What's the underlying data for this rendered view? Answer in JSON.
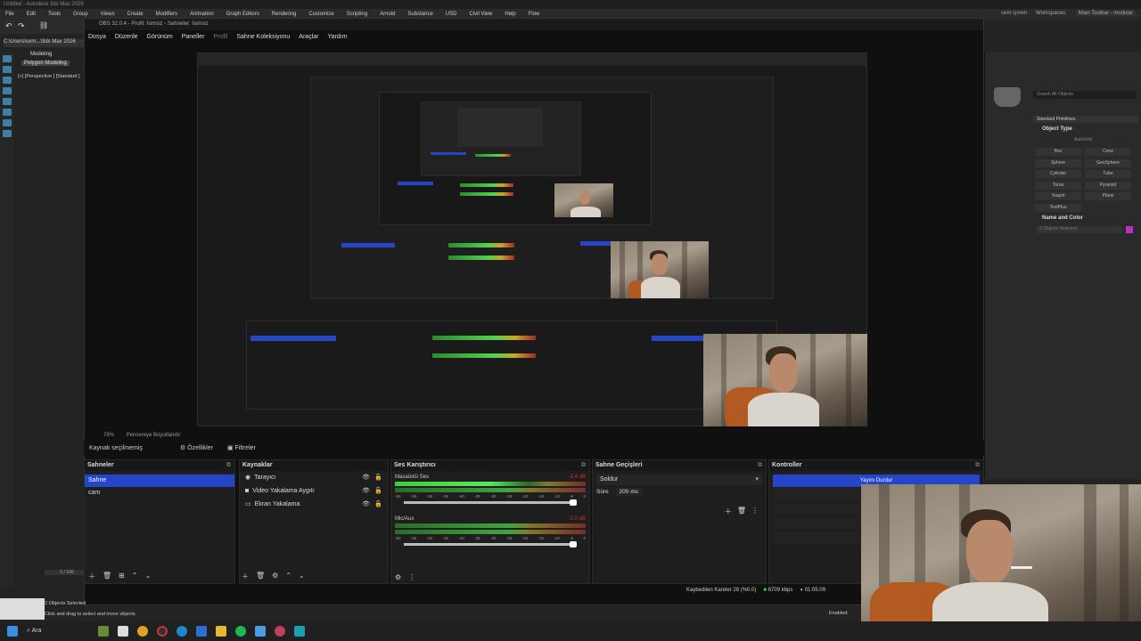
{
  "max": {
    "title": "Untitled - Autodesk 3ds Max 2026",
    "menu": [
      "File",
      "Edit",
      "Tools",
      "Group",
      "Views",
      "Create",
      "Modifiers",
      "Animation",
      "Graph Editors",
      "Rendering",
      "Customize",
      "Scripting",
      "Arnold",
      "Substance",
      "USD",
      "Civil View",
      "Help",
      "Flow"
    ],
    "user": "cem işmen",
    "workspaces_label": "Workspaces:",
    "workspace": "Main Toolbar - modular",
    "path": "C:\\Users\\cem...\\3ds Max 2026",
    "ribbon_tab": "Modeling",
    "ribbon_sub": "Polygon Modeling",
    "viewport_label": "[+] [Perspective ] [Standard ]",
    "command_panel": {
      "search": "Search All Objects",
      "category": "Standard Primitives",
      "object_type": "Object Type",
      "autogrid": "AutoGrid",
      "buttons": [
        "Box",
        "Cone",
        "Sphere",
        "GeoSphere",
        "Cylinder",
        "Tube",
        "Torus",
        "Pyramid",
        "Teapot",
        "Plane",
        "TextPlus"
      ],
      "name_color": "Name and Color",
      "selected": "2 Objects Selected"
    },
    "status": {
      "selected": "2 Objects Selected",
      "hint": "Click and drag to select and move objects",
      "frames": "0 / 100",
      "enabled": "Enabled:"
    }
  },
  "obs": {
    "title": "OBS 32.0.4 - Profil: İsimsiz - Sahneler: İsimsiz",
    "menu": [
      "Dosya",
      "Düzenle",
      "Görünüm",
      "Paneller",
      "Profil",
      "Sahne Koleksiyonu",
      "Araçlar",
      "Yardım"
    ],
    "zoom": "78%",
    "preview_fit": "Pencereye Boyutlandır",
    "source_bar": {
      "no_source": "Kaynak seçilmemiş",
      "properties": "Özellikler",
      "filters": "Filtreler"
    },
    "docks": {
      "scenes": {
        "title": "Sahneler",
        "items": [
          "Sahne",
          "cam"
        ]
      },
      "sources": {
        "title": "Kaynaklar",
        "items": [
          "Tarayıcı",
          "Video Yakalama Aygıtı",
          "Ekran Yakalama"
        ]
      },
      "mixer": {
        "title": "Ses Karıştırıcı",
        "channels": [
          {
            "name": "Masaüstü Ses",
            "db": "-3.4 dB"
          },
          {
            "name": "Mic/Aux",
            "db": "0.0 dB"
          }
        ],
        "scale": [
          "-60",
          "-55",
          "-50",
          "-45",
          "-40",
          "-35",
          "-30",
          "-25",
          "-20",
          "-15",
          "-10",
          "-5",
          "0"
        ]
      },
      "transitions": {
        "title": "Sahne Geçişleri",
        "type": "Soldur",
        "duration_label": "Süre",
        "duration": "200 ms"
      },
      "controls": {
        "title": "Kontroller",
        "stop_stream": "Yayını Durdur",
        "virtual_cam": "Sanal Ka"
      }
    },
    "status": {
      "dropped": "Kaybedilen Kareler 28 (%0.0)",
      "bitrate": "6709 kbps",
      "time": "01:05:09"
    }
  },
  "taskbar": {
    "search": "Ara"
  }
}
